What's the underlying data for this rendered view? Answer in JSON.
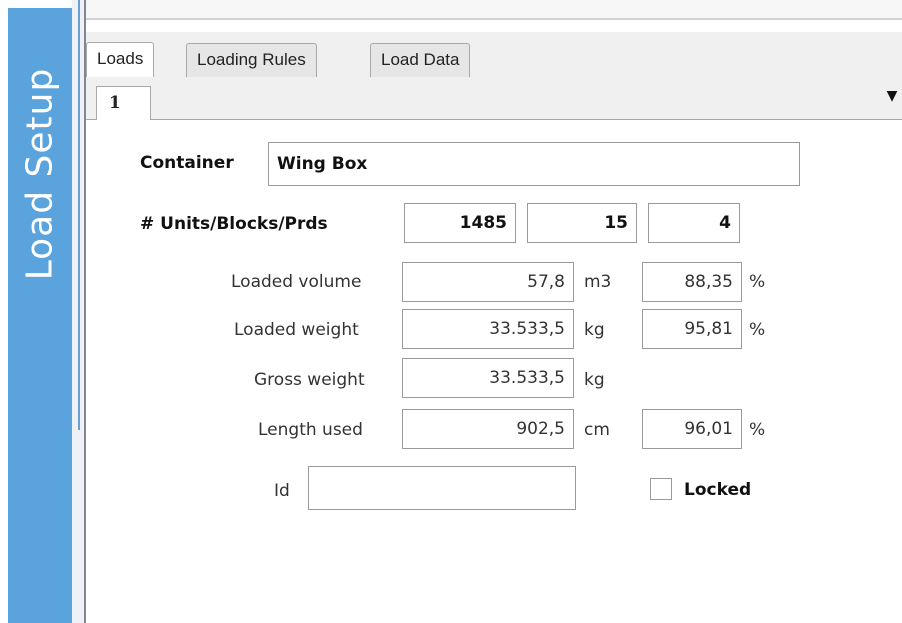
{
  "sidebar": {
    "title": "Load Setup"
  },
  "tabs": [
    {
      "label": "Loads",
      "active": true
    },
    {
      "label": "Loading Rules",
      "active": false
    },
    {
      "label": "Load Data",
      "active": false
    }
  ],
  "subtab": {
    "label": "1"
  },
  "form": {
    "container_label": "Container",
    "container_value": "Wing Box",
    "units_label": "# Units/Blocks/Prds",
    "units": "1485",
    "blocks": "15",
    "prds": "4",
    "loaded_volume_label": "Loaded volume",
    "loaded_volume": "57,8",
    "loaded_volume_unit": "m3",
    "loaded_volume_pct": "88,35",
    "loaded_weight_label": "Loaded weight",
    "loaded_weight": "33.533,5",
    "loaded_weight_unit": "kg",
    "loaded_weight_pct": "95,81",
    "gross_weight_label": "Gross weight",
    "gross_weight": "33.533,5",
    "gross_weight_unit": "kg",
    "length_used_label": "Length used",
    "length_used": "902,5",
    "length_used_unit": "cm",
    "length_used_pct": "96,01",
    "percent_symbol": "%",
    "id_label": "Id",
    "id_value": "",
    "locked_label": "Locked",
    "locked": false
  },
  "icons": {
    "dropdown": "chevron-down-icon"
  },
  "colors": {
    "sidebar": "#5aa3dc"
  }
}
